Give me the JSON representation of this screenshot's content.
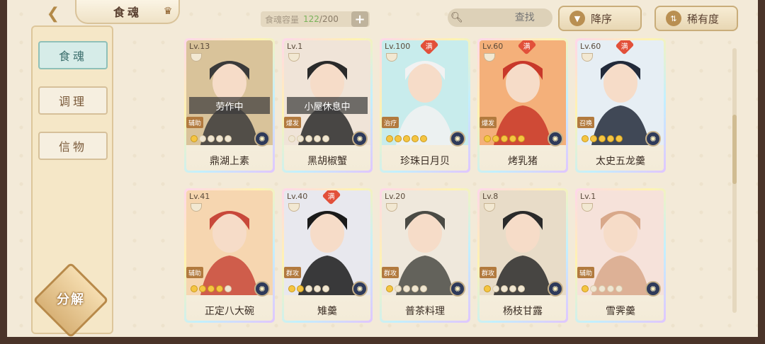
{
  "header": {
    "title": "食魂",
    "capacity_label": "食魂容量",
    "capacity_current": "122",
    "capacity_max": "/200",
    "add_label": "+",
    "search_placeholder": "查找",
    "sort_desc_label": "降序",
    "sort_rarity_label": "稀有度"
  },
  "sidebar": {
    "items": [
      {
        "label": "食魂",
        "active": true
      },
      {
        "label": "调理",
        "active": false
      },
      {
        "label": "信物",
        "active": false
      }
    ],
    "decompose_label": "分解"
  },
  "cards": [
    {
      "level": "Lv.13",
      "name": "鼎湖上素",
      "status": "劳作中",
      "role": "辅助",
      "stars": 1,
      "max": false
    },
    {
      "level": "Lv.1",
      "name": "黑胡椒蟹",
      "status": "小屋休息中",
      "role": "爆发",
      "stars": 0,
      "max": false
    },
    {
      "level": "Lv.100",
      "name": "珍珠日月贝",
      "status": "",
      "role": "治疗",
      "stars": 5,
      "max": true
    },
    {
      "level": "Lv.60",
      "name": "烤乳猪",
      "status": "",
      "role": "爆发",
      "stars": 5,
      "max": true
    },
    {
      "level": "Lv.60",
      "name": "太史五龙羹",
      "status": "",
      "role": "召唤",
      "stars": 5,
      "max": true
    },
    {
      "level": "Lv.41",
      "name": "正定八大碗",
      "status": "",
      "role": "辅助",
      "stars": 4,
      "max": false
    },
    {
      "level": "Lv.40",
      "name": "雉羹",
      "status": "",
      "role": "群攻",
      "stars": 2,
      "max": true
    },
    {
      "level": "Lv.20",
      "name": "普茶料理",
      "status": "",
      "role": "群攻",
      "stars": 1,
      "max": false
    },
    {
      "level": "Lv.8",
      "name": "杨枝甘露",
      "status": "",
      "role": "群攻",
      "stars": 1,
      "max": false
    },
    {
      "level": "Lv.1",
      "name": "雪霁羹",
      "status": "",
      "role": "辅助",
      "stars": 1,
      "max": false
    }
  ],
  "max_badge": "满",
  "colors": {
    "accent": "#b98f52",
    "active_tab": "#d6ece8",
    "frame": "#4a3429"
  }
}
